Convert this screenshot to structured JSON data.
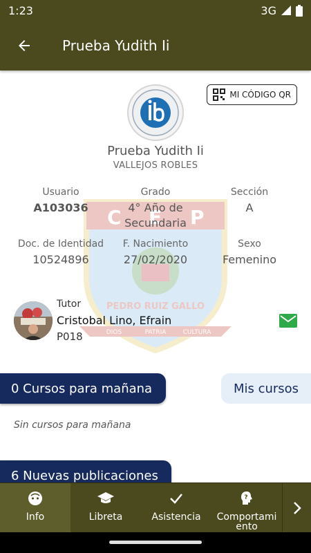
{
  "status": {
    "time": "1:23",
    "network": "3G"
  },
  "header": {
    "title": "Prueba Yudith Ii"
  },
  "profile": {
    "qr_label": "MI CÓDIGO QR",
    "name": "Prueba Yudith Ii",
    "surname": "VALLEJOS ROBLES",
    "fields": [
      {
        "label": "Usuario",
        "value": "A103036"
      },
      {
        "label": "Grado",
        "value": "4° Año de Secundaria"
      },
      {
        "label": "Sección",
        "value": "A"
      },
      {
        "label": "Doc. de Identidad",
        "value": "10524896"
      },
      {
        "label": "F. Nacimiento",
        "value": "27/02/2020"
      },
      {
        "label": "Sexo",
        "value": "Femenino"
      }
    ]
  },
  "watermark": {
    "letters": [
      "C",
      "E",
      "P"
    ],
    "ribbon_text": "PEDRO RUIZ GALLO",
    "motto": [
      "DIOS",
      "PATRIA",
      "CULTURA"
    ]
  },
  "tutor": {
    "label": "Tutor",
    "name": "Cristobal Lino, Efrain",
    "code": "P018"
  },
  "courses": {
    "tomorrow_label": "0 Cursos para mañana",
    "my_courses_label": "Mis cursos",
    "empty_text": "Sin cursos para mañana",
    "publications_label": "6 Nuevas publicaciones"
  },
  "nav": {
    "items": [
      {
        "label": "Info",
        "icon": "face-icon"
      },
      {
        "label": "Libreta",
        "icon": "graduation-cap-icon"
      },
      {
        "label": "Asistencia",
        "icon": "check-icon"
      },
      {
        "label": "Comportamiento",
        "icon": "behavior-icon"
      }
    ],
    "active_index": 0
  },
  "colors": {
    "app_bar": "#4a4a1e",
    "pill_dark": "#172a5e",
    "pill_light": "#e6eef7",
    "mail": "#2eaa4a"
  }
}
